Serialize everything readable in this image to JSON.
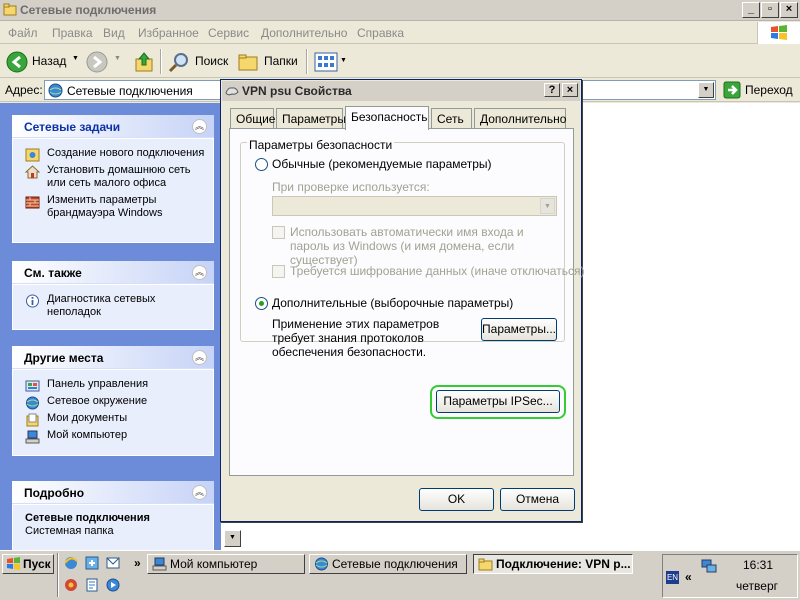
{
  "window": {
    "title": "Сетевые подключения",
    "controls": {
      "minimize": "_",
      "maximize": "▫",
      "close": "×"
    }
  },
  "menu": [
    "Файл",
    "Правка",
    "Вид",
    "Избранное",
    "Сервис",
    "Дополнительно",
    "Справка"
  ],
  "toolbar": {
    "back_label": "Назад",
    "search_label": "Поиск",
    "folders_label": "Папки"
  },
  "address": {
    "label": "Адрес:",
    "value": "Сетевые подключения",
    "go_label": "Переход"
  },
  "tasks": {
    "network": {
      "title": "Сетевые задачи",
      "items": [
        "Создание нового подключения",
        "Установить домашнюю сеть или сеть малого офиса",
        "Изменить параметры брандмауэра Windows"
      ]
    },
    "see_also": {
      "title": "См. также",
      "items": [
        "Диагностика сетевых неполадок"
      ]
    },
    "other_places": {
      "title": "Другие места",
      "items": [
        "Панель управления",
        "Сетевое окружение",
        "Мои документы",
        "Мой компьютер"
      ]
    },
    "details": {
      "title": "Подробно",
      "name": "Сетевые подключения",
      "type": "Системная папка"
    }
  },
  "dialog": {
    "title": "VPN psu Свойства",
    "help": "?",
    "close": "×",
    "tabs": [
      "Общие",
      "Параметры",
      "Безопасность",
      "Сеть",
      "Дополнительно"
    ],
    "active_tab": "Безопасность",
    "group_label": "Параметры безопасности",
    "typical_option": "Обычные (рекомендуемые параметры)",
    "verify_label": "При проверке используется:",
    "auto_logon": "Использовать автоматически имя входа и пароль из Windows (и имя домена, если существует)",
    "require_encryption": "Требуется шифрование данных (иначе отключаться)",
    "advanced_option": "Дополнительные (выборочные параметры)",
    "advanced_note": "Применение этих параметров требует знания протоколов обеспечения безопасности.",
    "settings_button": "Параметры...",
    "ipsec_button": "Параметры IPSec...",
    "ok_button": "OK",
    "cancel_button": "Отмена",
    "highlight_color": "#33cc33"
  },
  "taskbar": {
    "start_label": "Пуск",
    "windows": [
      "Мой компьютер",
      "Сетевые подключения",
      "Подключение: VPN p..."
    ],
    "active_window_index": 2,
    "language": "EN",
    "time": "16:31",
    "day": "четверг",
    "overflow": "»",
    "tray_arrow": "«"
  },
  "colors": {
    "taskpane_bg": "#6c8bd8",
    "taskpane_panel": "#d6dff7",
    "xp_green": "#21a121"
  }
}
